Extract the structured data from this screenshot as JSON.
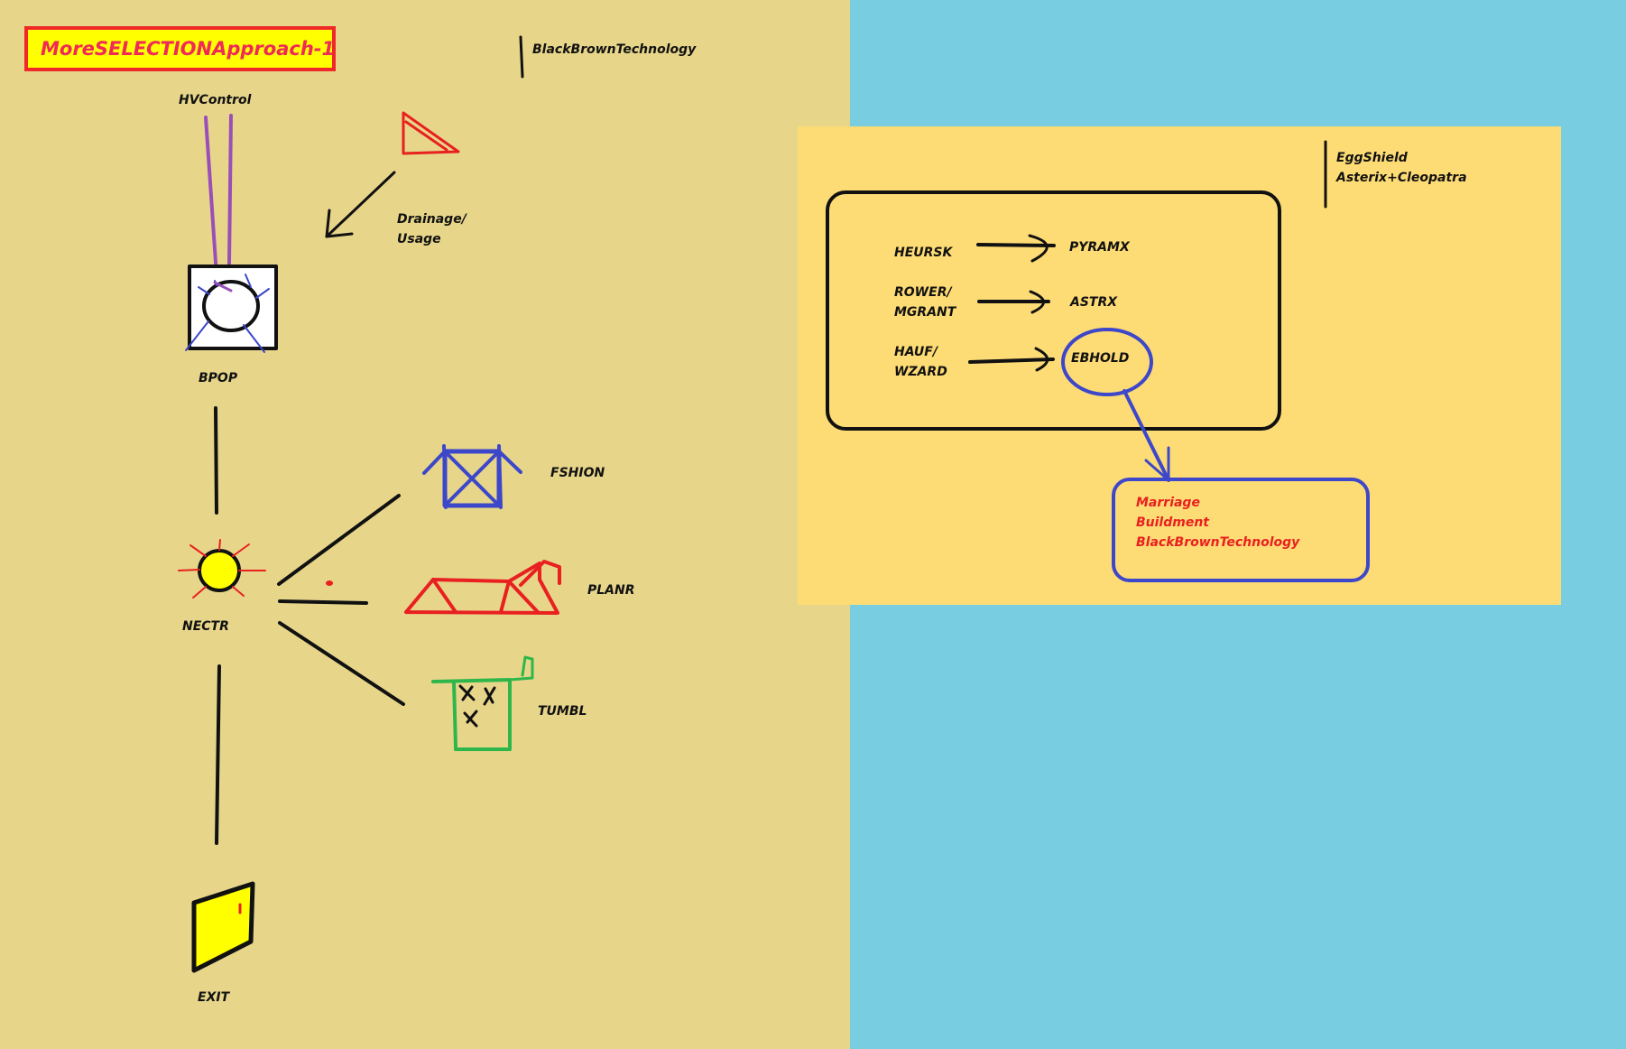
{
  "title": "MoreSELECTIONApproach-1",
  "top_note": "BlackBrownTechnology",
  "left_flow": {
    "hvcontrol": "HVControl",
    "drainage_line1": "Drainage/",
    "drainage_line2": "Usage",
    "bpop": "BPOP",
    "nectr": "NECTR",
    "exit": "EXIT",
    "fshion": "FSHION",
    "planr": "PLANR",
    "tumbl": "TUMBL"
  },
  "right_panel": {
    "note_line1": "EggShield",
    "note_line2": "Asterix+Cleopatra",
    "mappings": [
      {
        "from_line1": "HEURSK",
        "from_line2": "",
        "to": "PYRAMX"
      },
      {
        "from_line1": "ROWER/",
        "from_line2": "MGRANT",
        "to": "ASTRX"
      },
      {
        "from_line1": "HAUF/",
        "from_line2": "WZARD",
        "to": "EBHOLD"
      }
    ],
    "detail_box": [
      "Marriage",
      "Buildment",
      "BlackBrownTechnology"
    ]
  },
  "colors": {
    "left_background": "#e7d68a",
    "right_background": "#78cde0",
    "panel": "#fedc75",
    "title_fill": "#ffff00",
    "title_border": "#ef2828",
    "title_text": "#ef2a57",
    "blue_ink": "#3d47c9",
    "red_ink": "#e82020",
    "green_ink": "#2fb64a",
    "purple_ink": "#9a4fb8"
  },
  "icons": [
    "triangle-icon",
    "lamp-icon",
    "sun-icon",
    "fshion-icon",
    "planr-icon",
    "tumbl-icon",
    "exit-door-icon"
  ]
}
